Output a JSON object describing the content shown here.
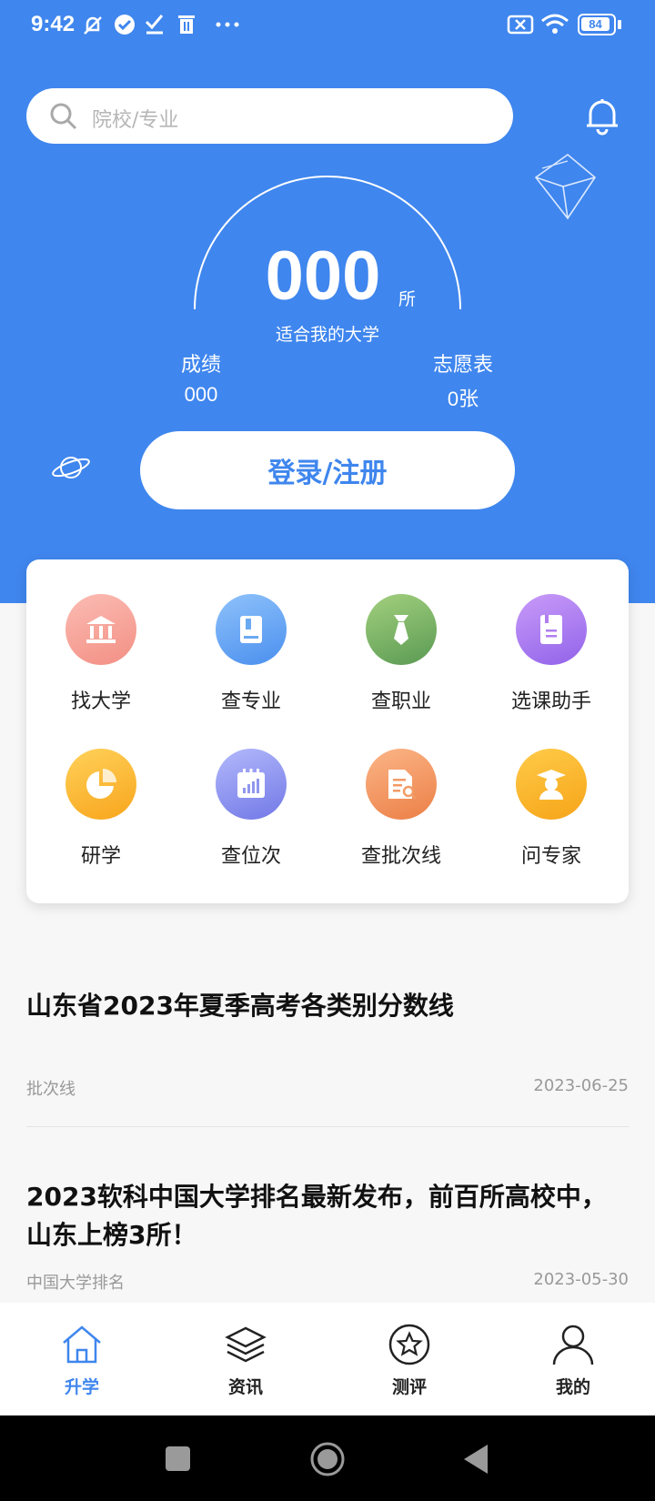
{
  "status": {
    "time": "9:42",
    "battery": "84"
  },
  "search": {
    "placeholder": "院校/专业"
  },
  "score_dial": {
    "count": "000",
    "unit": "所",
    "label": "适合我的大学"
  },
  "stats": {
    "score": {
      "title": "成绩",
      "value": "000"
    },
    "forms": {
      "title": "志愿表",
      "value": "0张"
    }
  },
  "login_button": "登录/注册",
  "tools": [
    {
      "label": "找大学",
      "icon": "university-icon",
      "color": "#f7a59b"
    },
    {
      "label": "查专业",
      "icon": "book-icon",
      "color": "#6aa9f2"
    },
    {
      "label": "查职业",
      "icon": "tie-icon",
      "color": "#84b86c"
    },
    {
      "label": "选课助手",
      "icon": "notebook-icon",
      "color": "#b07ef0"
    },
    {
      "label": "研学",
      "icon": "pie-chart-icon",
      "color": "#fbbf33"
    },
    {
      "label": "查位次",
      "icon": "rank-chart-icon",
      "color": "#8f97ee"
    },
    {
      "label": "查批次线",
      "icon": "document-search-icon",
      "color": "#f39a66"
    },
    {
      "label": "问专家",
      "icon": "expert-icon",
      "color": "#f9b52d"
    }
  ],
  "news": [
    {
      "title": "山东省2023年夏季高考各类别分数线",
      "tag": "批次线",
      "date": "2023-06-25"
    },
    {
      "title": "2023软科中国大学排名最新发布，前百所高校中，山东上榜3所！",
      "tag": "中国大学排名",
      "date": "2023-05-30"
    }
  ],
  "tabs": [
    {
      "label": "升学",
      "icon": "home-icon",
      "active": true
    },
    {
      "label": "资讯",
      "icon": "layers-icon",
      "active": false
    },
    {
      "label": "测评",
      "icon": "star-icon",
      "active": false
    },
    {
      "label": "我的",
      "icon": "person-icon",
      "active": false
    }
  ],
  "colors": {
    "primary": "#3f86ee",
    "background": "#f7f7f8"
  }
}
